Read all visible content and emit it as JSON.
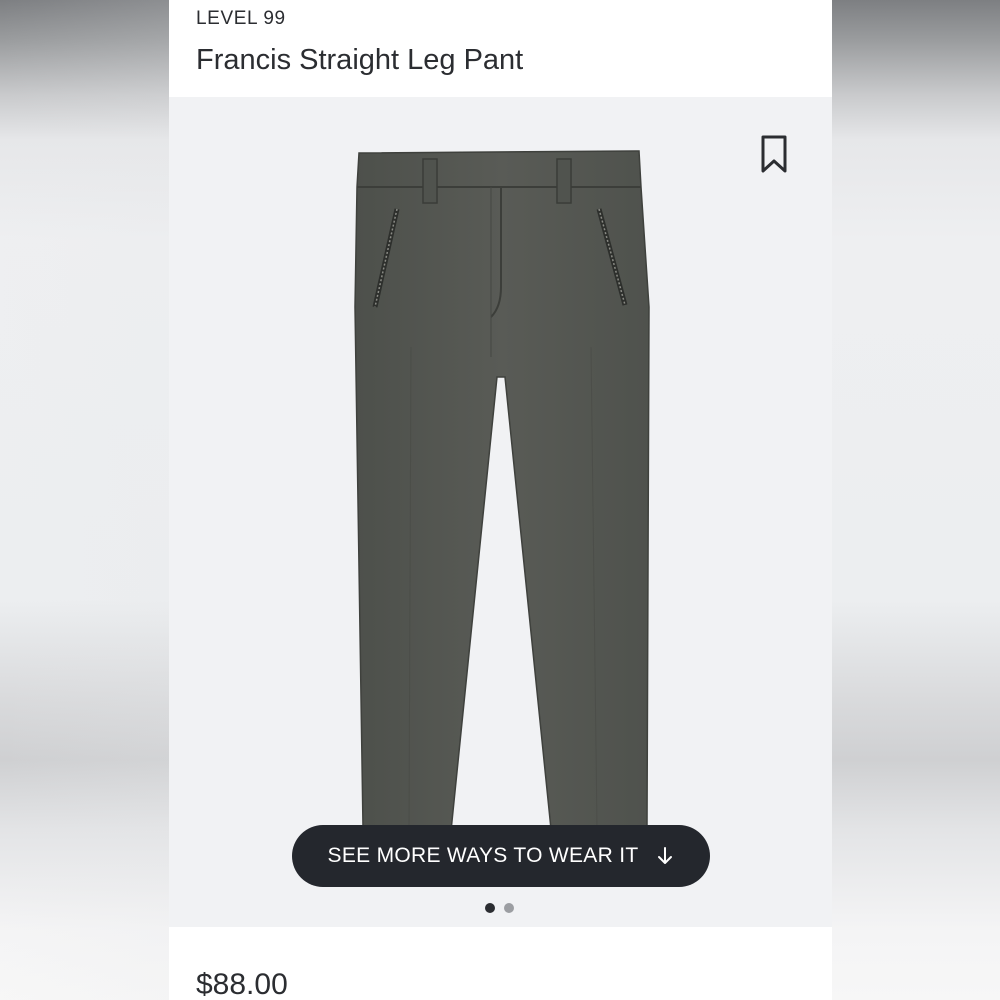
{
  "product": {
    "brand": "LEVEL 99",
    "name": "Francis Straight Leg Pant",
    "price": "$88.00"
  },
  "gallery": {
    "cta_label": "SEE MORE WAYS TO WEAR IT",
    "cta_icon": "arrow-down-icon",
    "save_icon": "bookmark-icon",
    "image_count": 2,
    "active_index": 0
  },
  "colors": {
    "cta_background": "#24272d",
    "image_background": "#f1f2f4",
    "text": "#2b2d31",
    "pant_color": "#545650"
  }
}
